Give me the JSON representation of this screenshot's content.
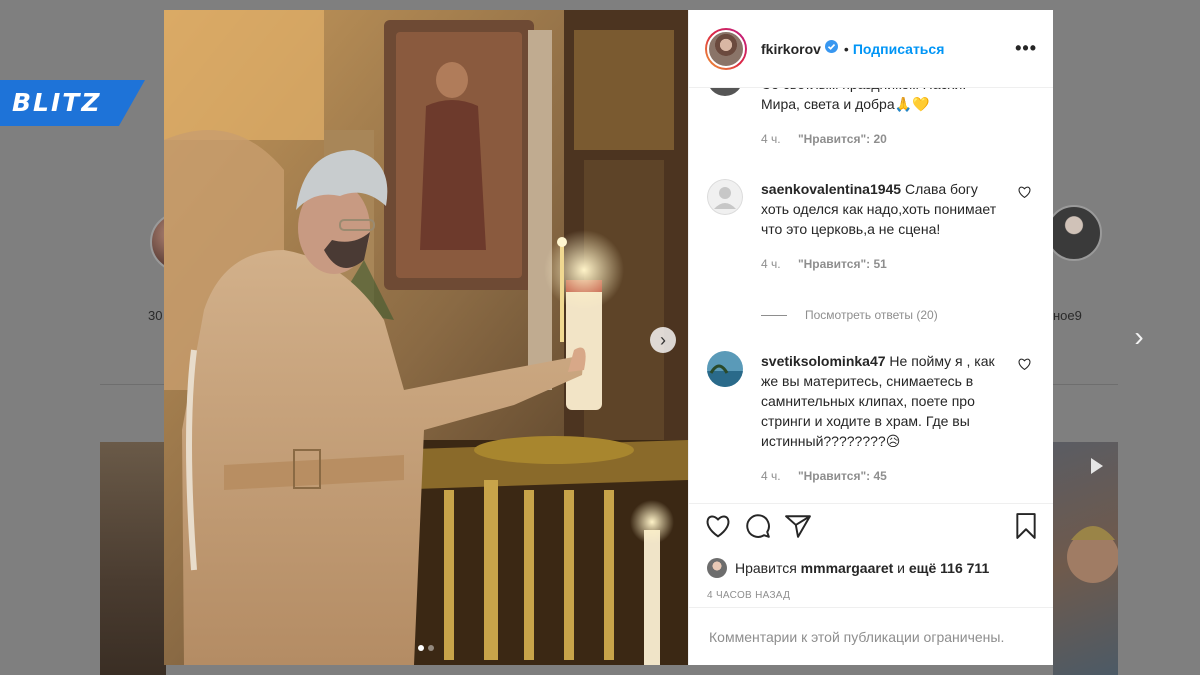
{
  "background": {
    "story_labels": [
      "30",
      "ное9"
    ],
    "next_arrow": "›"
  },
  "watermark": {
    "brand": "BLITZ"
  },
  "post": {
    "header": {
      "username": "fkirkorov",
      "separator": "•",
      "follow_label": "Подписаться",
      "more_label": "•••"
    },
    "photo": {
      "next_label": "›"
    },
    "comments": [
      {
        "username": "",
        "text": "Со светлым праздником Пасхи! Мира, света и добра🙏💛",
        "time": "4 ч.",
        "likes": "\"Нравится\": 20"
      },
      {
        "username": "saenkovalentina1945",
        "text": "Слава богу хоть оделся как надо,хоть понимает что это церковь,а не сцена!",
        "time": "4 ч.",
        "likes": "\"Нравится\": 51"
      },
      {
        "username": "svetiksolominka47",
        "text": "Не пойму я , как же вы материтесь, снимаетесь в самнительных клипах, поете про стринги и ходите в храм. Где вы истинный????????😥",
        "time": "4 ч.",
        "likes": "\"Нравится\": 45"
      }
    ],
    "view_replies": "Посмотреть ответы (20)",
    "likes_line": {
      "prefix": "Нравится",
      "user": "mmmargaaret",
      "connector": "и",
      "rest": "ещё 116 711"
    },
    "time_ago": "4 ЧАСОВ НАЗАД",
    "comments_limited": "Комментарии к этой публикации ограничены."
  },
  "colors": {
    "accent": "#0095f6",
    "muted": "#8e8e8e",
    "blitz": "#1e73d8",
    "verified": "#3897f0"
  }
}
